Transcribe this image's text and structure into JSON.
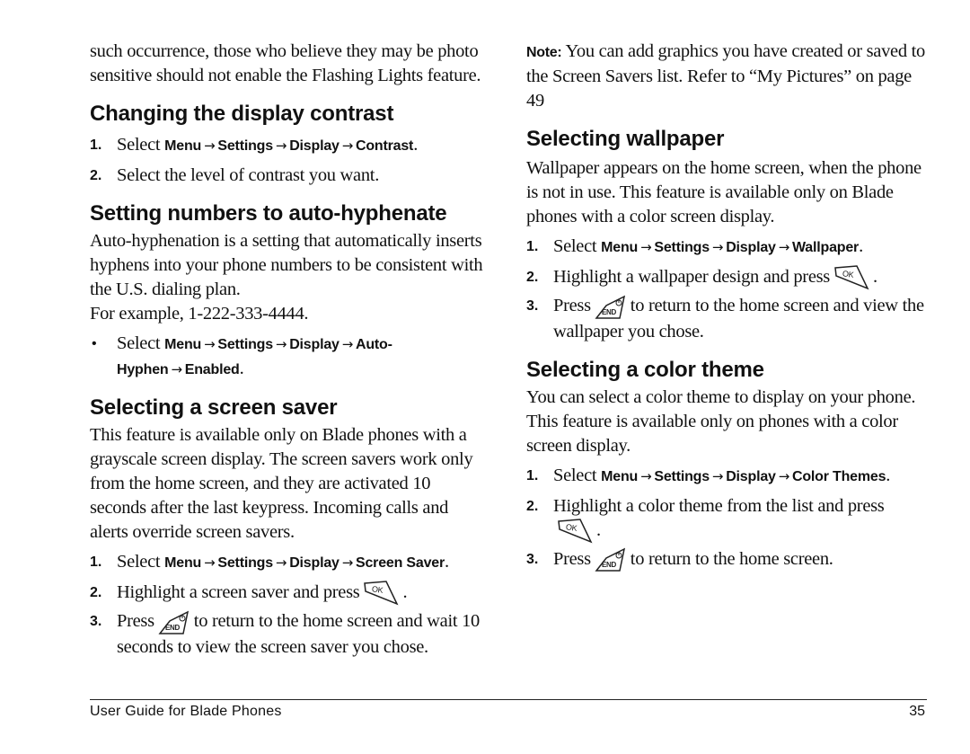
{
  "left_column": {
    "intro_paragraph": "such occurrence, those who believe they may be photo sensitive should not enable the Flashing Lights feature.",
    "contrast": {
      "heading": "Changing the display contrast",
      "steps": [
        {
          "num": "1.",
          "prefix": "Select ",
          "path": [
            "Menu",
            "Settings",
            "Display",
            "Contrast"
          ],
          "suffix": "."
        },
        {
          "num": "2.",
          "text": "Select the level of contrast you want."
        }
      ]
    },
    "hyphenate": {
      "heading": "Setting numbers to auto-hyphenate",
      "paragraph": "Auto-hyphenation is a setting that automatically inserts hyphens into your phone numbers to be consistent with the U.S. dialing plan.",
      "example": "For example, 1-222-333-4444.",
      "bullet": {
        "prefix": "Select ",
        "path": [
          "Menu",
          "Settings",
          "Display",
          "Auto-Hyphen",
          "Enabled"
        ],
        "suffix": "."
      }
    },
    "screensaver": {
      "heading": "Selecting a screen saver",
      "paragraph": "This feature is available only on Blade phones with a grayscale screen display. The screen savers work only from the home screen, and they are activated 10 seconds after the last keypress. Incoming calls and alerts override screen savers.",
      "steps": [
        {
          "num": "1.",
          "prefix": "Select ",
          "path": [
            "Menu",
            "Settings",
            "Display",
            "Screen Saver"
          ],
          "suffix": "."
        },
        {
          "num": "2.",
          "before": "Highlight a screen saver and press",
          "key": "ok-key",
          "after": "."
        },
        {
          "num": "3.",
          "before": "Press",
          "key": "end-key",
          "after": "to return to the home screen and wait 10 seconds to view the screen saver you chose."
        }
      ]
    }
  },
  "right_column": {
    "note": {
      "label": "Note:",
      "text": "You can add graphics you have created or saved to the Screen Savers list. Refer to “My Pictures” on page 49"
    },
    "wallpaper": {
      "heading": "Selecting wallpaper",
      "paragraph": "Wallpaper appears on the home screen, when the phone is not in use. This feature is available only on Blade phones with a color screen display.",
      "steps": [
        {
          "num": "1.",
          "prefix": "Select ",
          "path": [
            "Menu",
            "Settings",
            "Display",
            "Wallpaper"
          ],
          "suffix": "."
        },
        {
          "num": "2.",
          "before": "Highlight a wallpaper design and press",
          "key": "ok-key",
          "after": "."
        },
        {
          "num": "3.",
          "before": "Press",
          "key": "end-key",
          "after": "to return to the home screen and view the wallpaper you chose."
        }
      ]
    },
    "color_theme": {
      "heading": "Selecting a color theme",
      "paragraph": "You can select a color theme to display on your phone. This feature is available only on phones with a color screen display.",
      "steps": [
        {
          "num": "1.",
          "prefix": "Select ",
          "path": [
            "Menu",
            "Settings",
            "Display",
            "Color Themes"
          ],
          "suffix": "."
        },
        {
          "num": "2.",
          "before": "Highlight a color theme from the list and press",
          "key": "ok-key",
          "after": "."
        },
        {
          "num": "3.",
          "before": "Press",
          "key": "end-key",
          "after": "to return to the home screen."
        }
      ]
    }
  },
  "icons": {
    "ok_key_label": "OK",
    "end_key_label": "END",
    "arrow": "→"
  },
  "footer": {
    "title": "User Guide for Blade Phones",
    "page_number": "35"
  }
}
